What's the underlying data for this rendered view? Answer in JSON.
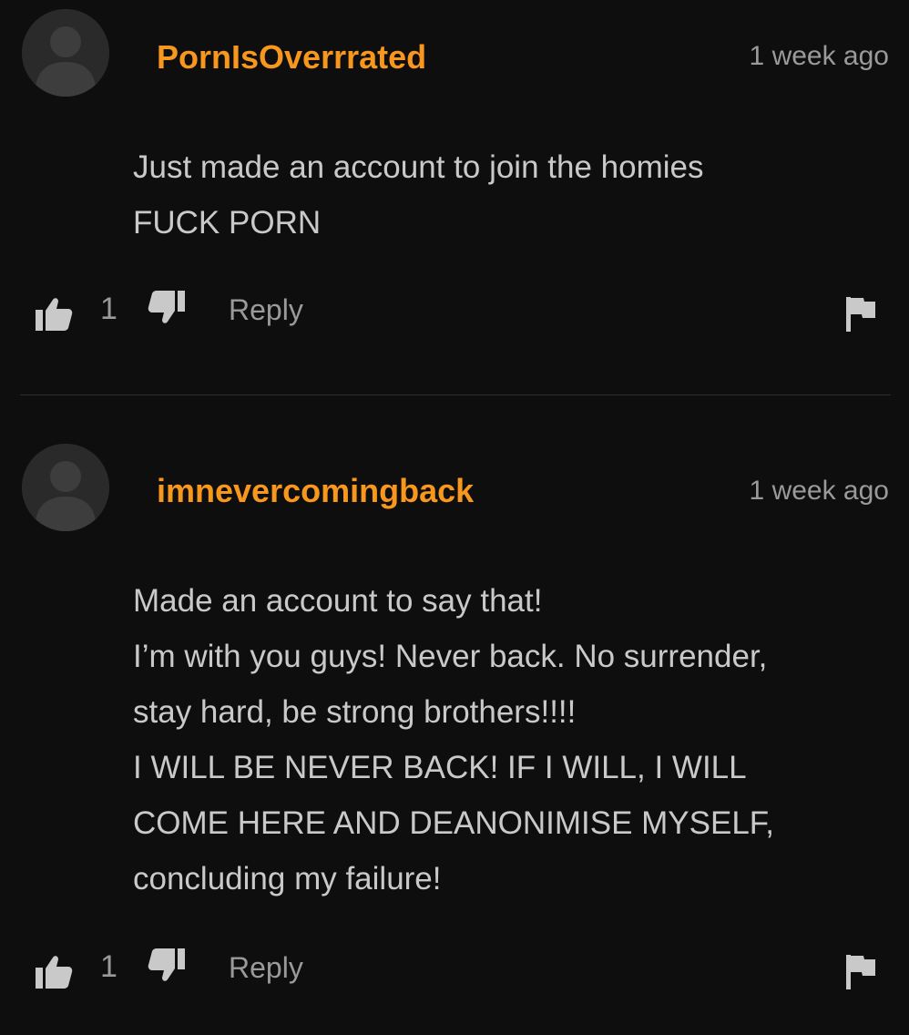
{
  "colors": {
    "username": "#f7971d",
    "text": "#c9c9c9",
    "muted": "#9a9a9a",
    "background": "#0e0e0e"
  },
  "comments": [
    {
      "username": "PornIsOverrrated",
      "timestamp": "1 week ago",
      "body": [
        "Just made an account to join the homies",
        "FUCK PORN"
      ],
      "likes": "1",
      "reply_label": "Reply",
      "icons": [
        "avatar-icon",
        "thumbs-up-icon",
        "thumbs-down-icon",
        "flag-icon"
      ]
    },
    {
      "username": "imnevercomingback",
      "timestamp": "1 week ago",
      "body": [
        "Made an account to say that!",
        "I’m with you guys! Never back. No surrender,",
        "stay hard, be strong brothers!!!!",
        "I WILL BE NEVER BACK! IF I WILL, I WILL",
        "COME HERE AND DEANONIMISE MYSELF,",
        "concluding my failure!"
      ],
      "likes": "1",
      "reply_label": "Reply",
      "icons": [
        "avatar-icon",
        "thumbs-up-icon",
        "thumbs-down-icon",
        "flag-icon"
      ]
    }
  ]
}
